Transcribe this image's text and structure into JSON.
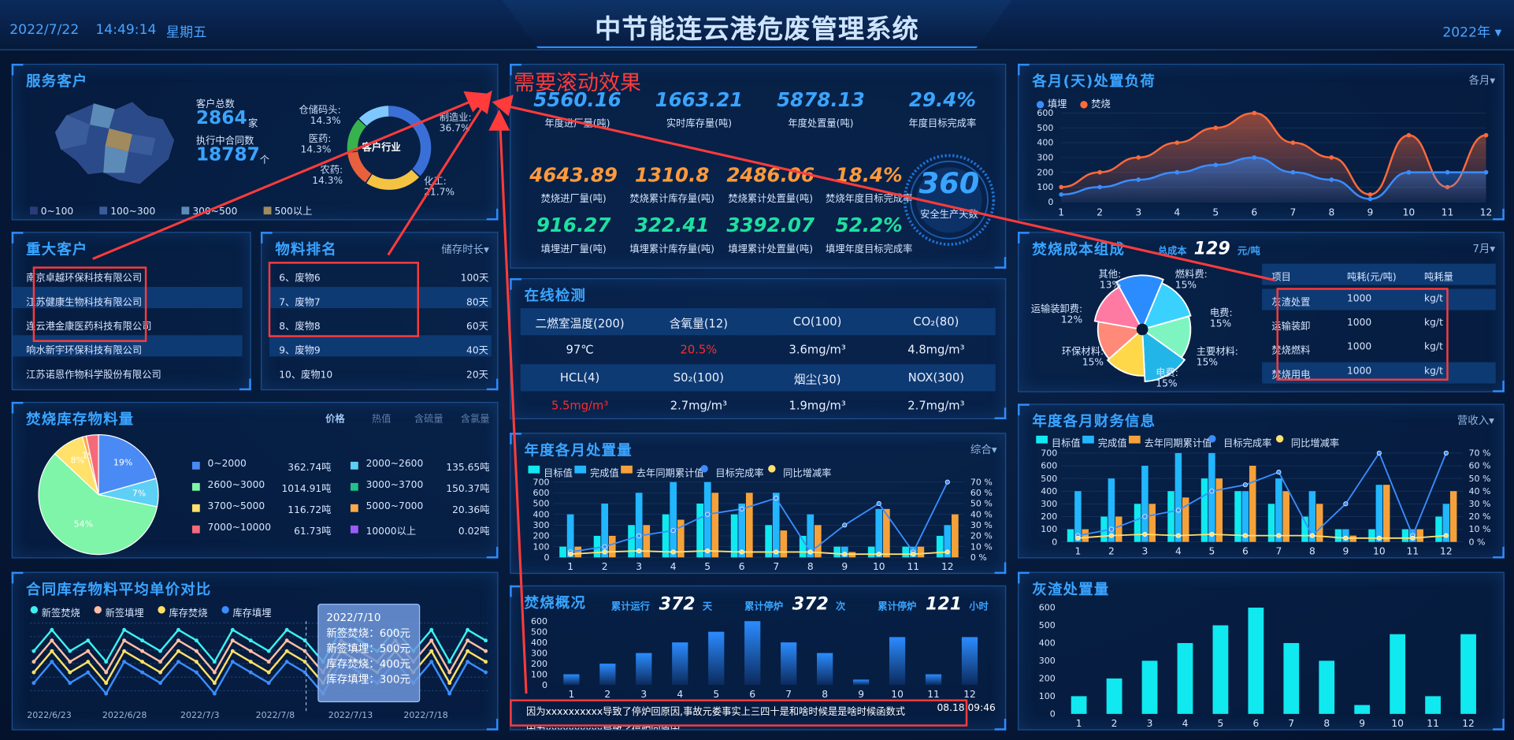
{
  "header": {
    "date": "2022/7/22",
    "time": "14:49:14",
    "weekday": "星期五",
    "title": "中节能连云港危废管理系统",
    "year_select": "2022年"
  },
  "annotation": {
    "text": "需要滚动效果",
    "color": "#ff3b3b"
  },
  "service": {
    "title": "服务客户",
    "total_label": "客户总数",
    "total_value": "2864",
    "total_unit": "家",
    "contracts_label": "执行中合同数",
    "contracts_value": "18787",
    "contracts_unit": "个",
    "donut_center": "客户行业",
    "slices": [
      {
        "label": "仓储码头",
        "pct": "14.3%"
      },
      {
        "label": "医药",
        "pct": "14.3%"
      },
      {
        "label": "农药",
        "pct": "14.3%"
      },
      {
        "label": "制造业",
        "pct": "36.7%"
      },
      {
        "label": "化工",
        "pct": "21.7%"
      }
    ],
    "legend": [
      {
        "label": "0~100",
        "color": "#2a3d7a"
      },
      {
        "label": "100~300",
        "color": "#3b5c9a"
      },
      {
        "label": "300~500",
        "color": "#5c8bb8"
      },
      {
        "label": "500以上",
        "color": "#a08a5e"
      }
    ]
  },
  "major": {
    "title": "重大客户",
    "items": [
      "南京卓越环保科技有限公司",
      "江苏健康生物科技有限公司",
      "连云港金康医药科技有限公司",
      "响水新宇环保科技有限公司",
      "江苏诺恩作物科学股份有限公司"
    ]
  },
  "material": {
    "title": "物料排名",
    "sort": "储存时长",
    "items": [
      {
        "name": "6、废物6",
        "days": "100天"
      },
      {
        "name": "7、废物7",
        "days": "80天"
      },
      {
        "name": "8、废物8",
        "days": "60天"
      },
      {
        "name": "9、废物9",
        "days": "40天"
      },
      {
        "name": "10、废物10",
        "days": "20天"
      }
    ]
  },
  "stock": {
    "title": "焚烧库存物料量",
    "tabs": [
      "价格",
      "热值",
      "含硫量",
      "含氯量"
    ],
    "pie": [
      {
        "label": "19%",
        "value": 19,
        "color": "#4a8af4"
      },
      {
        "label": "7%",
        "value": 7,
        "color": "#5ecff5"
      },
      {
        "label": "54%",
        "value": 54,
        "color": "#7ef5a8"
      },
      {
        "label": "8%",
        "value": 8,
        "color": "#ffe16b"
      },
      {
        "label": "1%",
        "value": 1,
        "color": "#ffa94d"
      },
      {
        "label": "",
        "value": 3,
        "color": "#f46a7a"
      }
    ],
    "legend": [
      {
        "range": "0~2000",
        "val": "362.74吨",
        "color": "#4a8af4"
      },
      {
        "range": "2000~2600",
        "val": "135.65吨",
        "color": "#5ecff5"
      },
      {
        "range": "2600~3000",
        "val": "1014.91吨",
        "color": "#7ef5a8"
      },
      {
        "range": "3000~3700",
        "val": "150.37吨",
        "color": "#22c08a"
      },
      {
        "range": "3700~5000",
        "val": "116.72吨",
        "color": "#ffe16b"
      },
      {
        "range": "5000~7000",
        "val": "20.36吨",
        "color": "#ffa94d"
      },
      {
        "range": "7000~10000",
        "val": "61.73吨",
        "color": "#f46a7a"
      },
      {
        "range": "10000以上",
        "val": "0.02吨",
        "color": "#9b5cf6"
      }
    ]
  },
  "contract": {
    "title": "合同库存物料平均单价对比",
    "series": [
      {
        "name": "新签焚烧",
        "color": "#3ef0f0"
      },
      {
        "name": "新签填埋",
        "color": "#ffbfa3"
      },
      {
        "name": "库存焚烧",
        "color": "#ffe066"
      },
      {
        "name": "库存填埋",
        "color": "#3a8dff"
      }
    ],
    "xticks": [
      "2022/6/23",
      "2022/6/28",
      "2022/7/3",
      "2022/7/8",
      "2022/7/13",
      "2022/7/18"
    ],
    "tooltip": {
      "date": "2022/7/10",
      "lines": [
        "新签焚烧：600元",
        "新签填埋：500元",
        "库存焚烧：400元",
        "库存填埋：300元"
      ]
    }
  },
  "kpi": {
    "row1": [
      {
        "v": "5560.16",
        "l": "年度进厂量(吨)"
      },
      {
        "v": "1663.21",
        "l": "实时库存量(吨)"
      },
      {
        "v": "5878.13",
        "l": "年度处置量(吨)"
      },
      {
        "v": "29.4%",
        "l": "年度目标完成率"
      }
    ],
    "row2": [
      {
        "v": "4643.89",
        "l": "焚烧进厂量(吨)"
      },
      {
        "v": "1310.8",
        "l": "焚烧累计库存量(吨)"
      },
      {
        "v": "2486.06",
        "l": "焚烧累计处置量(吨)"
      },
      {
        "v": "18.4%",
        "l": "焚烧年度目标完成率"
      }
    ],
    "row3": [
      {
        "v": "916.27",
        "l": "填埋进厂量(吨)"
      },
      {
        "v": "322.41",
        "l": "填埋累计库存量(吨)"
      },
      {
        "v": "3392.07",
        "l": "填埋累计处置量(吨)"
      },
      {
        "v": "52.2%",
        "l": "填埋年度目标完成率"
      }
    ],
    "safe_days": "360",
    "safe_label": "安全生产天数"
  },
  "monitor": {
    "title": "在线检测",
    "h1": [
      "二燃室温度(200)",
      "含氧量(12)",
      "CO(100)",
      "CO₂(80)"
    ],
    "v1": [
      "97℃",
      "20.5%",
      "3.6mg/m³",
      "4.8mg/m³"
    ],
    "h2": [
      "HCL(4)",
      "S0₂(100)",
      "烟尘(30)",
      "NOX(300)"
    ],
    "v2": [
      "5.5mg/m³",
      "2.7mg/m³",
      "1.9mg/m³",
      "2.7mg/m³"
    ],
    "alert": "#ff2a2a"
  },
  "annual": {
    "title": "年度各月处置量",
    "select": "综合",
    "legend": [
      "目标值",
      "完成值",
      "去年同期累计值",
      "目标完成率",
      "同比增减率"
    ]
  },
  "burn": {
    "title": "焚烧概况",
    "run_label": "累计运行",
    "run_val": "372",
    "run_unit": "天",
    "stop_label": "累计停炉",
    "stop_val": "372",
    "stop_unit": "次",
    "stop2_label": "累计停炉",
    "stop2_val": "121",
    "stop2_unit": "小时",
    "log1": "因为xxxxxxxxxx导致了停炉回原因,事故元娄事实上三四十是和啥时候是是啥时候函数式",
    "log1_time": "08.18 09:46",
    "log2": "因为xxxxxxxxxx导致了停炉回原因"
  },
  "monthly": {
    "title": "各月(天)处置负荷",
    "select": "各月",
    "legend": [
      "填埋",
      "焚烧"
    ]
  },
  "cost": {
    "title": "焚烧成本组成",
    "total_label": "总成本",
    "total_val": "129",
    "total_unit": "元/吨",
    "select": "7月",
    "slices": [
      {
        "label": "燃料费",
        "pct": "15%"
      },
      {
        "label": "电费",
        "pct": "15%"
      },
      {
        "label": "主要材料",
        "pct": "15%"
      },
      {
        "label": "电费",
        "pct": "15%"
      },
      {
        "label": "环保材料",
        "pct": "15%"
      },
      {
        "label": "运输装卸费",
        "pct": "12%"
      },
      {
        "label": "其他",
        "pct": "13%"
      }
    ],
    "table_head": [
      "项目",
      "吨耗(元/吨)",
      "吨耗量"
    ],
    "table": [
      [
        "灰渣处置",
        "1000",
        "kg/t"
      ],
      [
        "运输装卸",
        "1000",
        "kg/t"
      ],
      [
        "焚烧燃料",
        "1000",
        "kg/t"
      ],
      [
        "焚烧用电",
        "1000",
        "kg/t"
      ]
    ]
  },
  "finance": {
    "title": "年度各月财务信息",
    "select": "营收入",
    "legend": [
      "目标值",
      "完成值",
      "去年同期累计值",
      "目标完成率",
      "同比增减率"
    ]
  },
  "ash": {
    "title": "灰渣处置量"
  },
  "chart_data": [
    {
      "id": "annual",
      "type": "bar",
      "categories": [
        "1",
        "2",
        "3",
        "4",
        "5",
        "6",
        "7",
        "8",
        "9",
        "10",
        "11",
        "12"
      ],
      "ylim": [
        0,
        700
      ],
      "y2lim": [
        0,
        70
      ],
      "series": [
        {
          "name": "目标值",
          "values": [
            100,
            200,
            300,
            400,
            500,
            400,
            300,
            200,
            100,
            100,
            100,
            200
          ]
        },
        {
          "name": "完成值",
          "values": [
            400,
            500,
            600,
            700,
            700,
            500,
            600,
            400,
            100,
            450,
            100,
            300
          ]
        },
        {
          "name": "去年同期累计值",
          "values": [
            100,
            200,
            300,
            350,
            600,
            600,
            250,
            300,
            50,
            450,
            100,
            400
          ]
        },
        {
          "name": "目标完成率",
          "values": [
            5,
            10,
            20,
            25,
            40,
            45,
            55,
            5,
            30,
            50,
            5,
            70
          ]
        },
        {
          "name": "同比增减率",
          "values": [
            3,
            5,
            6,
            5,
            6,
            5,
            5,
            5,
            3,
            3,
            3,
            5
          ]
        }
      ]
    },
    {
      "id": "burn",
      "type": "bar",
      "categories": [
        "1",
        "2",
        "3",
        "4",
        "5",
        "6",
        "7",
        "8",
        "9",
        "10",
        "11",
        "12"
      ],
      "ylim": [
        0,
        600
      ],
      "values": [
        100,
        200,
        300,
        400,
        500,
        600,
        400,
        300,
        50,
        450,
        100,
        450
      ]
    },
    {
      "id": "monthly",
      "type": "line",
      "categories": [
        "1",
        "2",
        "3",
        "4",
        "5",
        "6",
        "7",
        "8",
        "9",
        "10",
        "11",
        "12"
      ],
      "ylim": [
        0,
        600
      ],
      "series": [
        {
          "name": "填埋",
          "values": [
            50,
            100,
            150,
            200,
            250,
            300,
            200,
            150,
            20,
            200,
            200,
            200
          ]
        },
        {
          "name": "焚烧",
          "values": [
            100,
            200,
            300,
            400,
            500,
            600,
            400,
            300,
            50,
            450,
            100,
            450
          ]
        }
      ]
    },
    {
      "id": "finance",
      "type": "bar",
      "categories": [
        "1",
        "2",
        "3",
        "4",
        "5",
        "6",
        "7",
        "8",
        "9",
        "10",
        "11",
        "12"
      ],
      "ylim": [
        0,
        700
      ],
      "y2lim": [
        0,
        70
      ],
      "series": [
        {
          "name": "目标值",
          "values": [
            100,
            200,
            300,
            400,
            500,
            400,
            300,
            200,
            100,
            100,
            100,
            200
          ]
        },
        {
          "name": "完成值",
          "values": [
            400,
            500,
            600,
            700,
            700,
            400,
            500,
            400,
            100,
            450,
            100,
            300
          ]
        },
        {
          "name": "去年同期累计值",
          "values": [
            100,
            200,
            300,
            350,
            500,
            600,
            400,
            300,
            50,
            450,
            100,
            400
          ]
        },
        {
          "name": "目标完成率",
          "values": [
            5,
            10,
            20,
            25,
            40,
            45,
            55,
            5,
            30,
            70,
            5,
            70
          ]
        },
        {
          "name": "同比增减率",
          "values": [
            3,
            5,
            6,
            5,
            6,
            5,
            5,
            5,
            3,
            3,
            3,
            5
          ]
        }
      ]
    },
    {
      "id": "ash",
      "type": "bar",
      "categories": [
        "1",
        "2",
        "3",
        "4",
        "5",
        "6",
        "7",
        "8",
        "9",
        "10",
        "11",
        "12"
      ],
      "ylim": [
        0,
        600
      ],
      "values": [
        100,
        200,
        300,
        400,
        500,
        600,
        400,
        300,
        50,
        450,
        100,
        450
      ]
    },
    {
      "id": "contract",
      "type": "line",
      "x": [
        "2022/6/23",
        "2022/6/28",
        "2022/7/3",
        "2022/7/8",
        "2022/7/13",
        "2022/7/18"
      ],
      "ylim": [
        0,
        800
      ],
      "series": [
        {
          "name": "新签焚烧",
          "values": [
            500,
            700,
            500,
            600,
            400,
            700,
            600,
            500,
            700,
            600,
            400,
            700,
            600,
            500,
            700,
            600,
            400,
            700,
            600,
            500,
            700,
            500,
            700,
            400,
            700,
            600
          ]
        },
        {
          "name": "新签填埋",
          "values": [
            400,
            600,
            400,
            500,
            300,
            600,
            500,
            400,
            600,
            500,
            300,
            600,
            500,
            400,
            600,
            500,
            300,
            600,
            500,
            400,
            600,
            400,
            600,
            300,
            600,
            500
          ]
        },
        {
          "name": "库存焚烧",
          "values": [
            300,
            500,
            300,
            400,
            200,
            500,
            400,
            300,
            500,
            400,
            200,
            500,
            400,
            300,
            500,
            400,
            200,
            500,
            400,
            300,
            500,
            300,
            500,
            200,
            500,
            400
          ]
        },
        {
          "name": "库存填埋",
          "values": [
            200,
            400,
            200,
            300,
            100,
            400,
            300,
            200,
            400,
            300,
            100,
            400,
            300,
            200,
            400,
            300,
            100,
            400,
            300,
            200,
            400,
            200,
            400,
            100,
            400,
            300
          ]
        }
      ]
    }
  ]
}
